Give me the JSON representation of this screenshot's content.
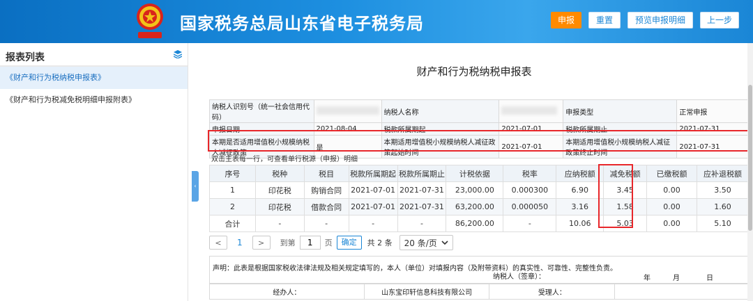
{
  "header": {
    "title": "国家税务总局山东省电子税务局",
    "buttons": {
      "declare": "申报",
      "reset": "重置",
      "preview": "预览申报明细",
      "back": "上一步"
    },
    "colors": {
      "accent": "#ff8a00",
      "brand": "#1a86d6"
    }
  },
  "sidebar": {
    "title": "报表列表",
    "icon": "layers-icon",
    "items": [
      {
        "label": "《财产和行为税纳税申报表》",
        "active": true
      },
      {
        "label": "《财产和行为税减免税明细申报附表》",
        "active": false
      }
    ]
  },
  "main": {
    "form_title": "财产和行为税纳税申报表",
    "info": {
      "taxpayer_id_label": "纳税人识别号（统一社会信用代码）",
      "taxpayer_name_label": "纳税人名称",
      "declare_type_label": "申报类型",
      "declare_type_value": "正常申报",
      "declare_date_label": "申报日期",
      "declare_date_value": "2021-08-04",
      "period_start_label": "税款所属期起",
      "period_start_value": "2021-07-01",
      "period_end_label": "税款所属期止",
      "period_end_value": "2021-07-31",
      "small_scale_label": "本期是否适用增值税小规模纳税人减征政策",
      "small_scale_value": "是",
      "policy_start_label": "本期适用增值税小规模纳税人减征政策起始时间",
      "policy_start_value": "2021-07-01",
      "policy_end_label": "本期适用增值税小规模纳税人减征政策终止时间",
      "policy_end_value": "2021-07-31"
    },
    "hint": "双击主表每一行，可查看单行税源（申报）明细",
    "table": {
      "headers": [
        "序号",
        "税种",
        "税目",
        "税款所属期起",
        "税款所属期止",
        "计税依据",
        "税率",
        "应纳税额",
        "减免税额",
        "已缴税额",
        "应补退税额"
      ],
      "rows": [
        [
          "1",
          "印花税",
          "购销合同",
          "2021-07-01",
          "2021-07-31",
          "23,000.00",
          "0.000300",
          "6.90",
          "3.45",
          "0.00",
          "3.50"
        ],
        [
          "2",
          "印花税",
          "借款合同",
          "2021-07-01",
          "2021-07-31",
          "63,200.00",
          "0.000050",
          "3.16",
          "1.58",
          "0.00",
          "1.60"
        ],
        [
          "合计",
          "-",
          "-",
          "-",
          "-",
          "86,200.00",
          "-",
          "10.06",
          "5.03",
          "0.00",
          "5.10"
        ]
      ]
    },
    "pager": {
      "prev": "<",
      "current": "1",
      "next": ">",
      "goto_label": "到第",
      "goto_value": "1",
      "page_label": "页",
      "confirm": "确定",
      "total": "共 2 条",
      "page_size": "20 条/页"
    },
    "declaration": {
      "statement": "声明：此表是根据国家税收法律法规及相关规定填写的，本人（单位）对填报内容（及附带资料）的真实性、可靠性、完整性负责。",
      "signer": "纳税人（签章）：",
      "year": "年",
      "month": "月",
      "day": "日"
    },
    "sign": {
      "handler_label": "经办人：",
      "agency": "山东宝印轩信息科技有限公司",
      "receiver_label": "受理人："
    }
  }
}
